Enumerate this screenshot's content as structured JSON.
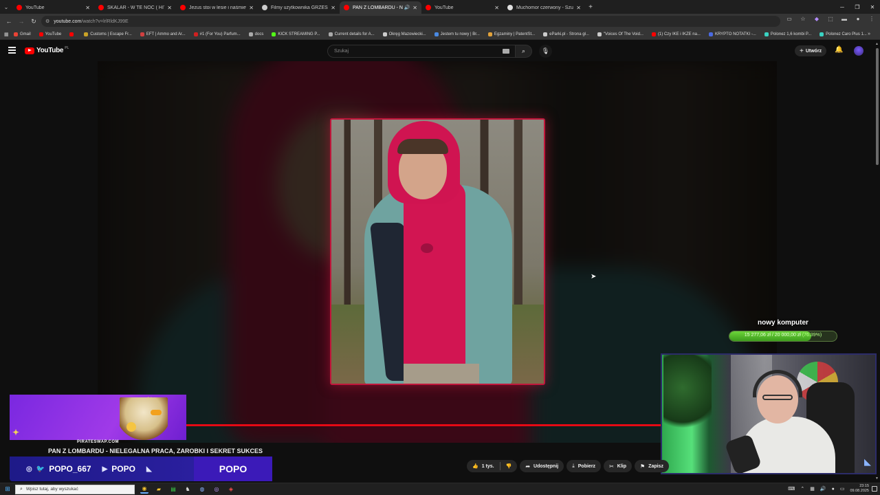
{
  "browser": {
    "tabs": [
      {
        "title": "YouTube",
        "favicon_color": "#ff0000",
        "active": false
      },
      {
        "title": "SKALAR - W TE NOC ( HIT Disc...",
        "favicon_color": "#ff0000",
        "active": false
      },
      {
        "title": "Jezus stoi w lesie i naśmiewa się...",
        "favicon_color": "#ff0000",
        "active": false
      },
      {
        "title": "Filmy użytkownika GRZESIU.PL",
        "favicon_color": "#cccccc",
        "active": false
      },
      {
        "title": "PAN Z LOMBARDU - NIELE...",
        "favicon_color": "#ff0000",
        "active": true,
        "audio": true
      },
      {
        "title": "YouTube",
        "favicon_color": "#ff0000",
        "active": false
      },
      {
        "title": "Muchomor czerwony - Szukaj w...",
        "favicon_color": "#e0e0e0",
        "active": false
      }
    ],
    "new_tab_label": "+",
    "url_host": "youtube.com",
    "url_path": "/watch?v=lrlRldKJ99E",
    "bookmarks": [
      {
        "label": "Gmail",
        "color": "#ea4335"
      },
      {
        "label": "YouTube",
        "color": "#ff0000"
      },
      {
        "label": "",
        "color": "#ff0000"
      },
      {
        "label": "Customs | Escape Fr...",
        "color": "#c9a227"
      },
      {
        "label": "EFT | Ammo and Ar...",
        "color": "#d04040"
      },
      {
        "label": "#1 (For You) Parfum...",
        "color": "#d02020"
      },
      {
        "label": "docs",
        "color": "#aaaaaa"
      },
      {
        "label": "KICK STREAMING P...",
        "color": "#53fc18"
      },
      {
        "label": "Current details for A...",
        "color": "#aaaaaa"
      },
      {
        "label": "Okręg Mazowiecki...",
        "color": "#cccccc"
      },
      {
        "label": "Jestem tu nowy | Br...",
        "color": "#4a8ae2"
      },
      {
        "label": "Egzaminy | PatentSt...",
        "color": "#e2a23a"
      },
      {
        "label": "eParki.pl - Strona gł...",
        "color": "#cccccc"
      },
      {
        "label": "\"Voices Of The Void...",
        "color": "#cccccc"
      },
      {
        "label": "(1) Czy IKE i IKZE na...",
        "color": "#ff0000"
      },
      {
        "label": "KRYPTO NOTATKI -...",
        "color": "#4a6ae2"
      },
      {
        "label": "Polonez 1,6 kombi P...",
        "color": "#3ad2c2"
      },
      {
        "label": "Polonez Caro Plus 1...",
        "color": "#3ad2c2"
      }
    ]
  },
  "youtube": {
    "logo_text": "YouTube",
    "region": "PL",
    "search_placeholder": "Szukaj",
    "create_label": "Utwórz",
    "video_title": "PAN Z LOMBARDU - NIELEGALNA PRACA, ZAROBKI I SEKRET SUKCES",
    "progress_fraction": 0.965,
    "actions": {
      "likes": "1 tys.",
      "share": "Udostępnij",
      "download": "Pobierz",
      "clip": "Klip",
      "save": "Zapisz"
    }
  },
  "stream_overlay": {
    "goal_title": "nowy komputer",
    "goal_amount": "15 277,06 zł / 20 000,00 zł",
    "goal_percent_text": "(76.39%)",
    "goal_fraction": 0.7639,
    "ad_caption": "PIRATESWAP.COM",
    "social": {
      "instagram_handle": "POPO_667",
      "youtube_name": "POPO",
      "kick_name": "POPO"
    }
  },
  "taskbar": {
    "search_placeholder": "Wpisz tutaj, aby wyszukać",
    "time": "23:15",
    "date": "09.08.2025"
  }
}
